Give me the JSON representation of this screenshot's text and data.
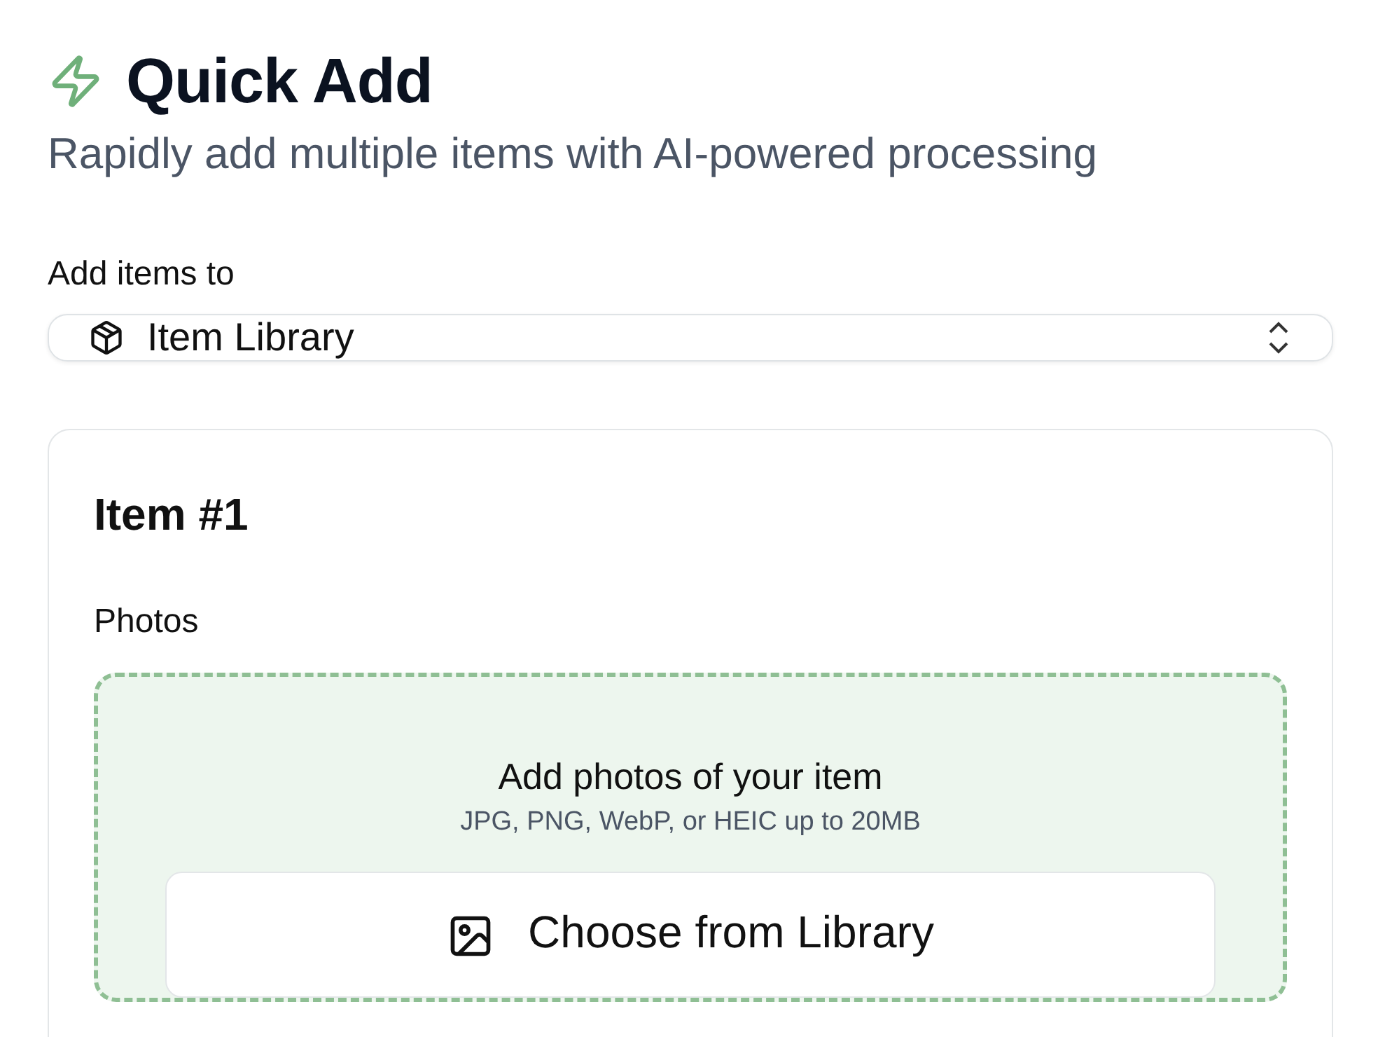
{
  "header": {
    "title": "Quick Add",
    "subtitle": "Rapidly add multiple items with AI-powered processing"
  },
  "destination": {
    "label": "Add items to",
    "value": "Item Library"
  },
  "items": [
    {
      "title": "Item #1",
      "photos_label": "Photos",
      "dropzone": {
        "title": "Add photos of your item",
        "hint": "JPG, PNG, WebP, or HEIC up to 20MB",
        "button": "Choose from Library"
      }
    }
  ]
}
